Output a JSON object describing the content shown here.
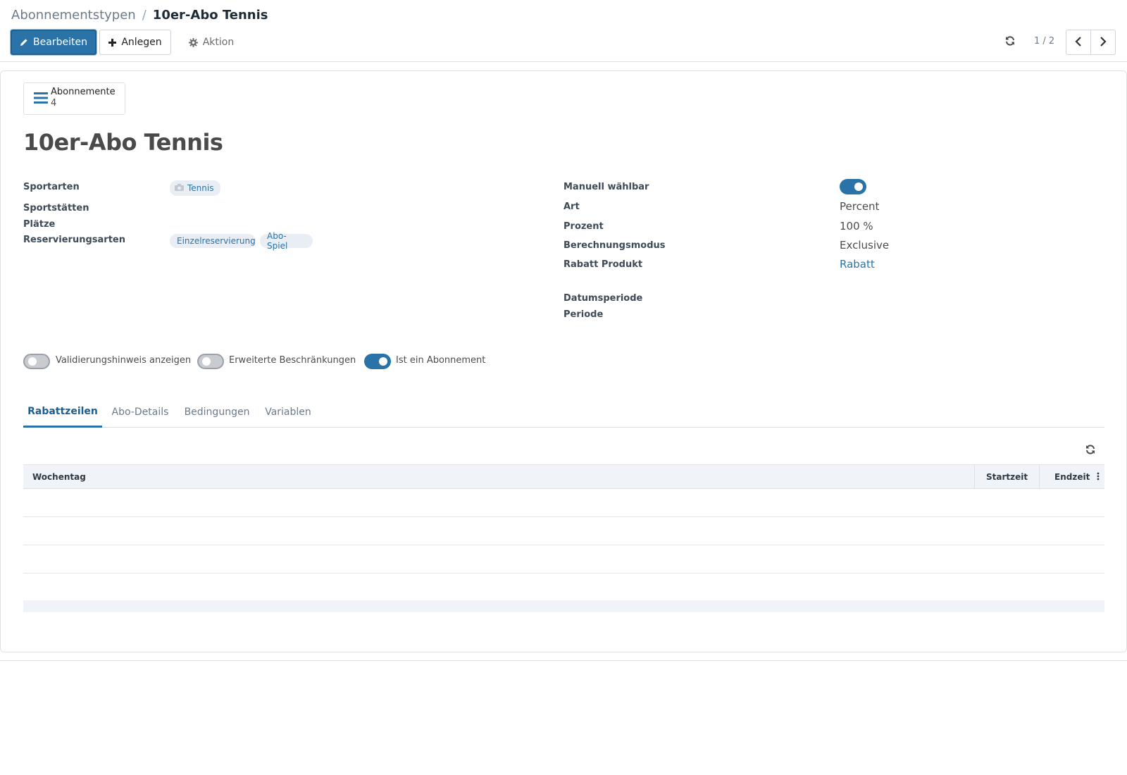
{
  "breadcrumb": {
    "parent": "Abonnementstypen",
    "separator": "/",
    "current": "10er-Abo Tennis"
  },
  "toolbar": {
    "edit_label": "Bearbeiten",
    "create_label": "Anlegen",
    "action_label": "Aktion"
  },
  "pager": {
    "value": "1 / 2"
  },
  "stat_button": {
    "label": "Abonnemente",
    "count": "4"
  },
  "record": {
    "title": "10er-Abo Tennis"
  },
  "left_fields": {
    "sportarten_label": "Sportarten",
    "sportarten_tags": [
      "Tennis"
    ],
    "sportstaetten_label": "Sportstätten",
    "plaetze_label": "Plätze",
    "reservierungsarten_label": "Reservierungsarten",
    "reservierungsarten_tags": [
      "Einzelreservierung",
      "Abo-Spiel"
    ]
  },
  "right_fields": {
    "manuell_label": "Manuell wählbar",
    "manuell_value": true,
    "art_label": "Art",
    "art_value": "Percent",
    "prozent_label": "Prozent",
    "prozent_value": "100 %",
    "berechnung_label": "Berechnungsmodus",
    "berechnung_value": "Exclusive",
    "rabatt_label": "Rabatt Produkt",
    "rabatt_value": "Rabatt",
    "datumsperiode_label": "Datumsperiode",
    "periode_label": "Periode"
  },
  "toggles": [
    {
      "label": "Validierungshinweis anzeigen",
      "on": false
    },
    {
      "label": "Erweiterte Beschränkungen",
      "on": false
    },
    {
      "label": "Ist ein Abonnement",
      "on": true
    }
  ],
  "tabs": [
    "Rabattzeilen",
    "Abo-Details",
    "Bedingungen",
    "Variablen"
  ],
  "active_tab": "Rabattzeilen",
  "table": {
    "columns": [
      "Wochentag",
      "Startzeit",
      "Endzeit"
    ],
    "rows": []
  },
  "colors": {
    "primary": "#2a73a8",
    "tag_bg": "#e8eef4",
    "header_bg": "#f0f3f7"
  }
}
